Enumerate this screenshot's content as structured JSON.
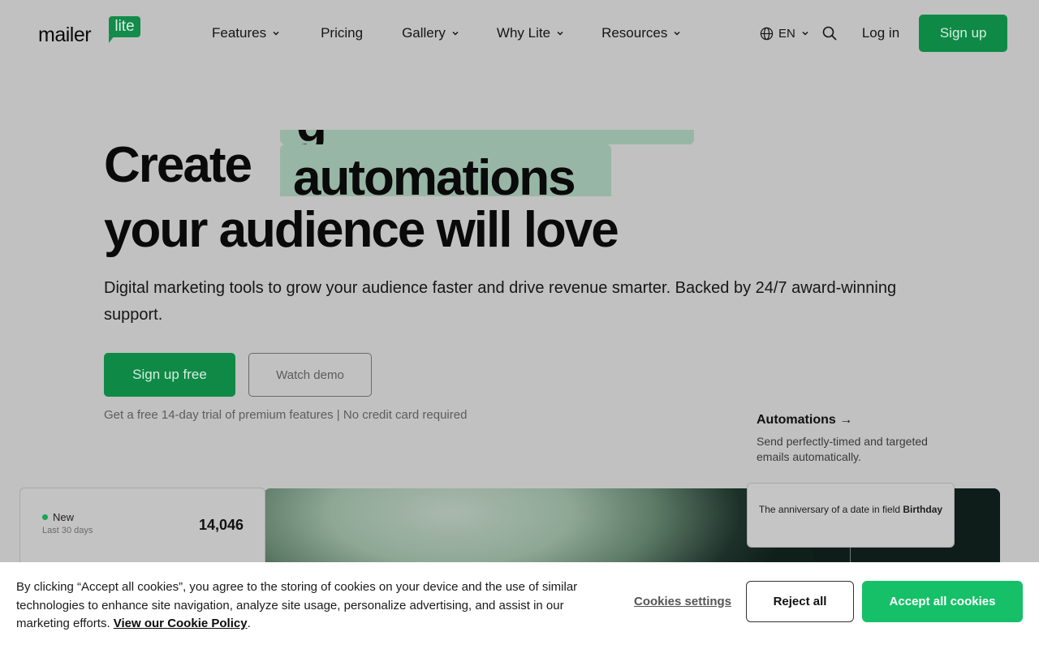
{
  "logo": {
    "text": "mailer",
    "badge": "lite"
  },
  "nav": {
    "features": "Features",
    "pricing": "Pricing",
    "gallery": "Gallery",
    "why": "Why Lite",
    "resources": "Resources"
  },
  "header": {
    "language": "EN",
    "login": "Log in",
    "signup": "Sign up"
  },
  "hero": {
    "title_prefix": "Create",
    "rotating_word_prev": "g",
    "rotating_word": "automations",
    "title_line2": "your audience will love",
    "subtitle": "Digital marketing tools to grow your audience faster and drive revenue smarter. Backed by 24/7 award-winning support.",
    "cta_primary": "Sign up free",
    "cta_secondary": "Watch demo",
    "trial_note": "Get a free 14-day trial of premium features | No credit card required"
  },
  "feature": {
    "link": "Automations →",
    "description": "Send perfectly-timed and targeted emails automatically."
  },
  "stat_card": {
    "label": "New",
    "period": "Last 30 days",
    "value": "14,046"
  },
  "trigger_card": {
    "text": "The anniversary of a date in field",
    "field": "Birthday"
  },
  "cookie": {
    "text": "By clicking “Accept all cookies”, you agree to the storing of cookies on your device and the use of similar technologies to enhance site navigation, analyze site usage, personalize advertising, and assist in our marketing efforts.",
    "policy_link": "View our Cookie Policy",
    "policy_suffix": ".",
    "settings": "Cookies settings",
    "reject": "Reject all",
    "accept": "Accept all cookies"
  },
  "colors": {
    "brand_green": "#0f8a46",
    "accept_green": "#16c068",
    "highlight": "#98b6a6",
    "overlay_bg": "#c1c1c1"
  }
}
